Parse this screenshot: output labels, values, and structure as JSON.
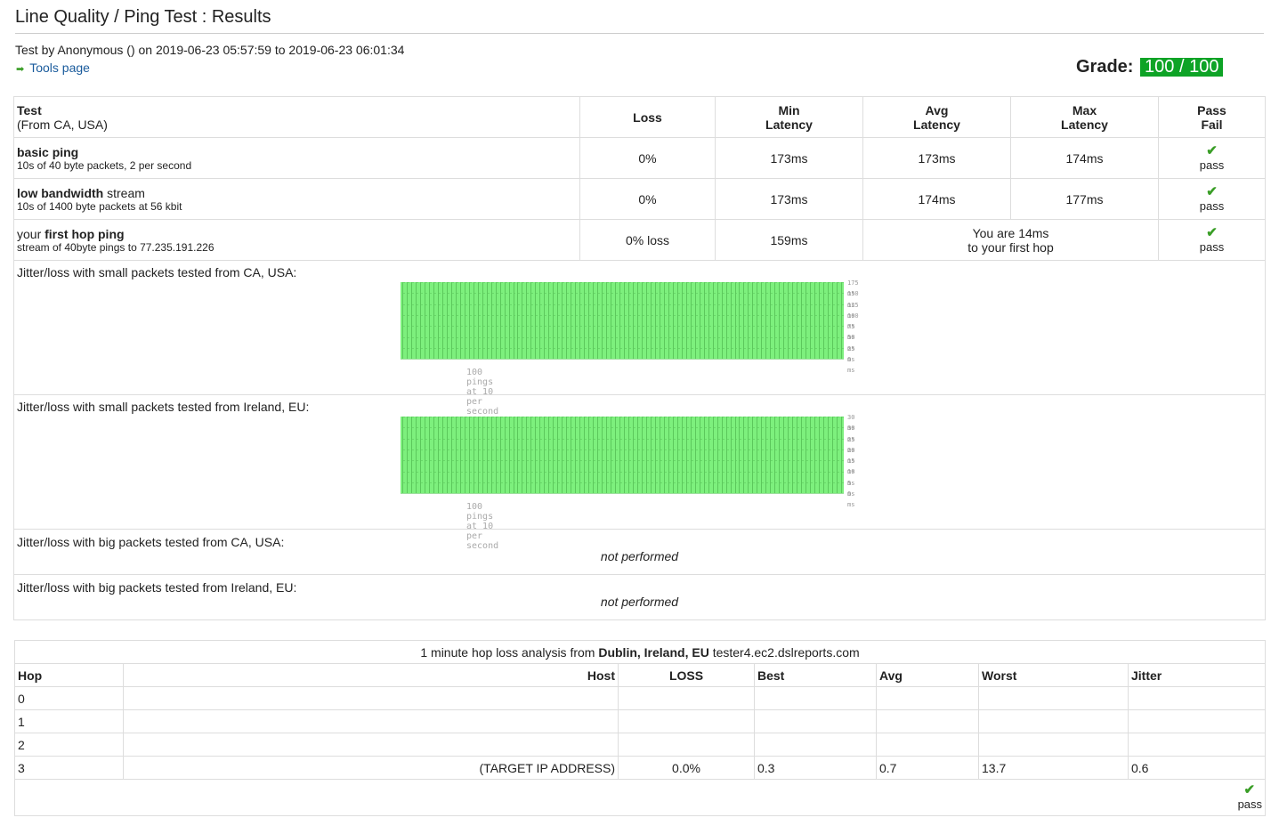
{
  "page": {
    "title": "Line Quality / Ping Test : Results",
    "subline": "Test by Anonymous () on 2019-06-23 05:57:59 to 2019-06-23 06:01:34",
    "tools_link": "Tools page",
    "grade_label": "Grade:",
    "grade_value": "100 / 100"
  },
  "results": {
    "headers": {
      "test": "Test",
      "test_sub": "(From CA, USA)",
      "loss": "Loss",
      "min_l1": "Min",
      "min_l2": "Latency",
      "avg_l1": "Avg",
      "avg_l2": "Latency",
      "max_l1": "Max",
      "max_l2": "Latency",
      "pf_l1": "Pass",
      "pf_l2": "Fail"
    },
    "rows": [
      {
        "name_bold": "basic ping",
        "name_rest": "",
        "desc": "10s of 40 byte packets, 2 per second",
        "loss": "0%",
        "min": "173ms",
        "avg": "173ms",
        "max": "174ms",
        "result": "pass"
      },
      {
        "name_bold": "low bandwidth",
        "name_rest": " stream",
        "desc": "10s of 1400 byte packets at 56 kbit",
        "loss": "0%",
        "min": "173ms",
        "avg": "174ms",
        "max": "177ms",
        "result": "pass"
      },
      {
        "name_pre": "your ",
        "name_bold": "first hop ping",
        "desc": "stream of 40byte pings to 77.235.191.226",
        "loss": "0% loss",
        "min": "159ms",
        "note_l1": "You are 14ms",
        "note_l2": "to your first hop",
        "result": "pass"
      }
    ],
    "jitter": [
      {
        "label": "Jitter/loss with small packets tested from CA, USA:",
        "caption": "100 pings at 10 per second",
        "ticks": [
          "175 ms",
          "150 ms",
          "125 ms",
          "100 ms",
          "75 ms",
          "50 ms",
          "25 ms",
          "0 ms"
        ]
      },
      {
        "label": "Jitter/loss with small packets tested from Ireland, EU:",
        "caption": "100 pings at 10 per second",
        "ticks": [
          "30 ms",
          "30 ms",
          "25 ms",
          "20 ms",
          "15 ms",
          "10 ms",
          "5 ms",
          "0 ms"
        ]
      },
      {
        "label": "Jitter/loss with big packets tested from CA, USA:",
        "status": "not performed"
      },
      {
        "label": "Jitter/loss with big packets tested from Ireland, EU:",
        "status": "not performed"
      }
    ]
  },
  "hops": {
    "caption_pre": "1 minute hop loss analysis from ",
    "caption_bold": "Dublin, Ireland, EU",
    "caption_post": " tester4.ec2.dslreports.com",
    "headers": [
      "Hop",
      "Host",
      "LOSS",
      "Best",
      "Avg",
      "Worst",
      "Jitter"
    ],
    "rows": [
      [
        "0",
        "",
        "",
        "",
        "",
        "",
        ""
      ],
      [
        "1",
        "",
        "",
        "",
        "",
        "",
        ""
      ],
      [
        "2",
        "",
        "",
        "",
        "",
        "",
        ""
      ],
      [
        "3",
        "(TARGET IP ADDRESS)",
        "0.0%",
        "0.3",
        "0.7",
        "13.7",
        "0.6"
      ]
    ],
    "result": "pass"
  },
  "icons": {
    "check": "check-icon",
    "arrow": "arrow-right-icon"
  },
  "colors": {
    "grade_bg": "#0ea326",
    "bars": "#7df07d",
    "link": "#1a5b9c",
    "check": "#3a9e27"
  }
}
